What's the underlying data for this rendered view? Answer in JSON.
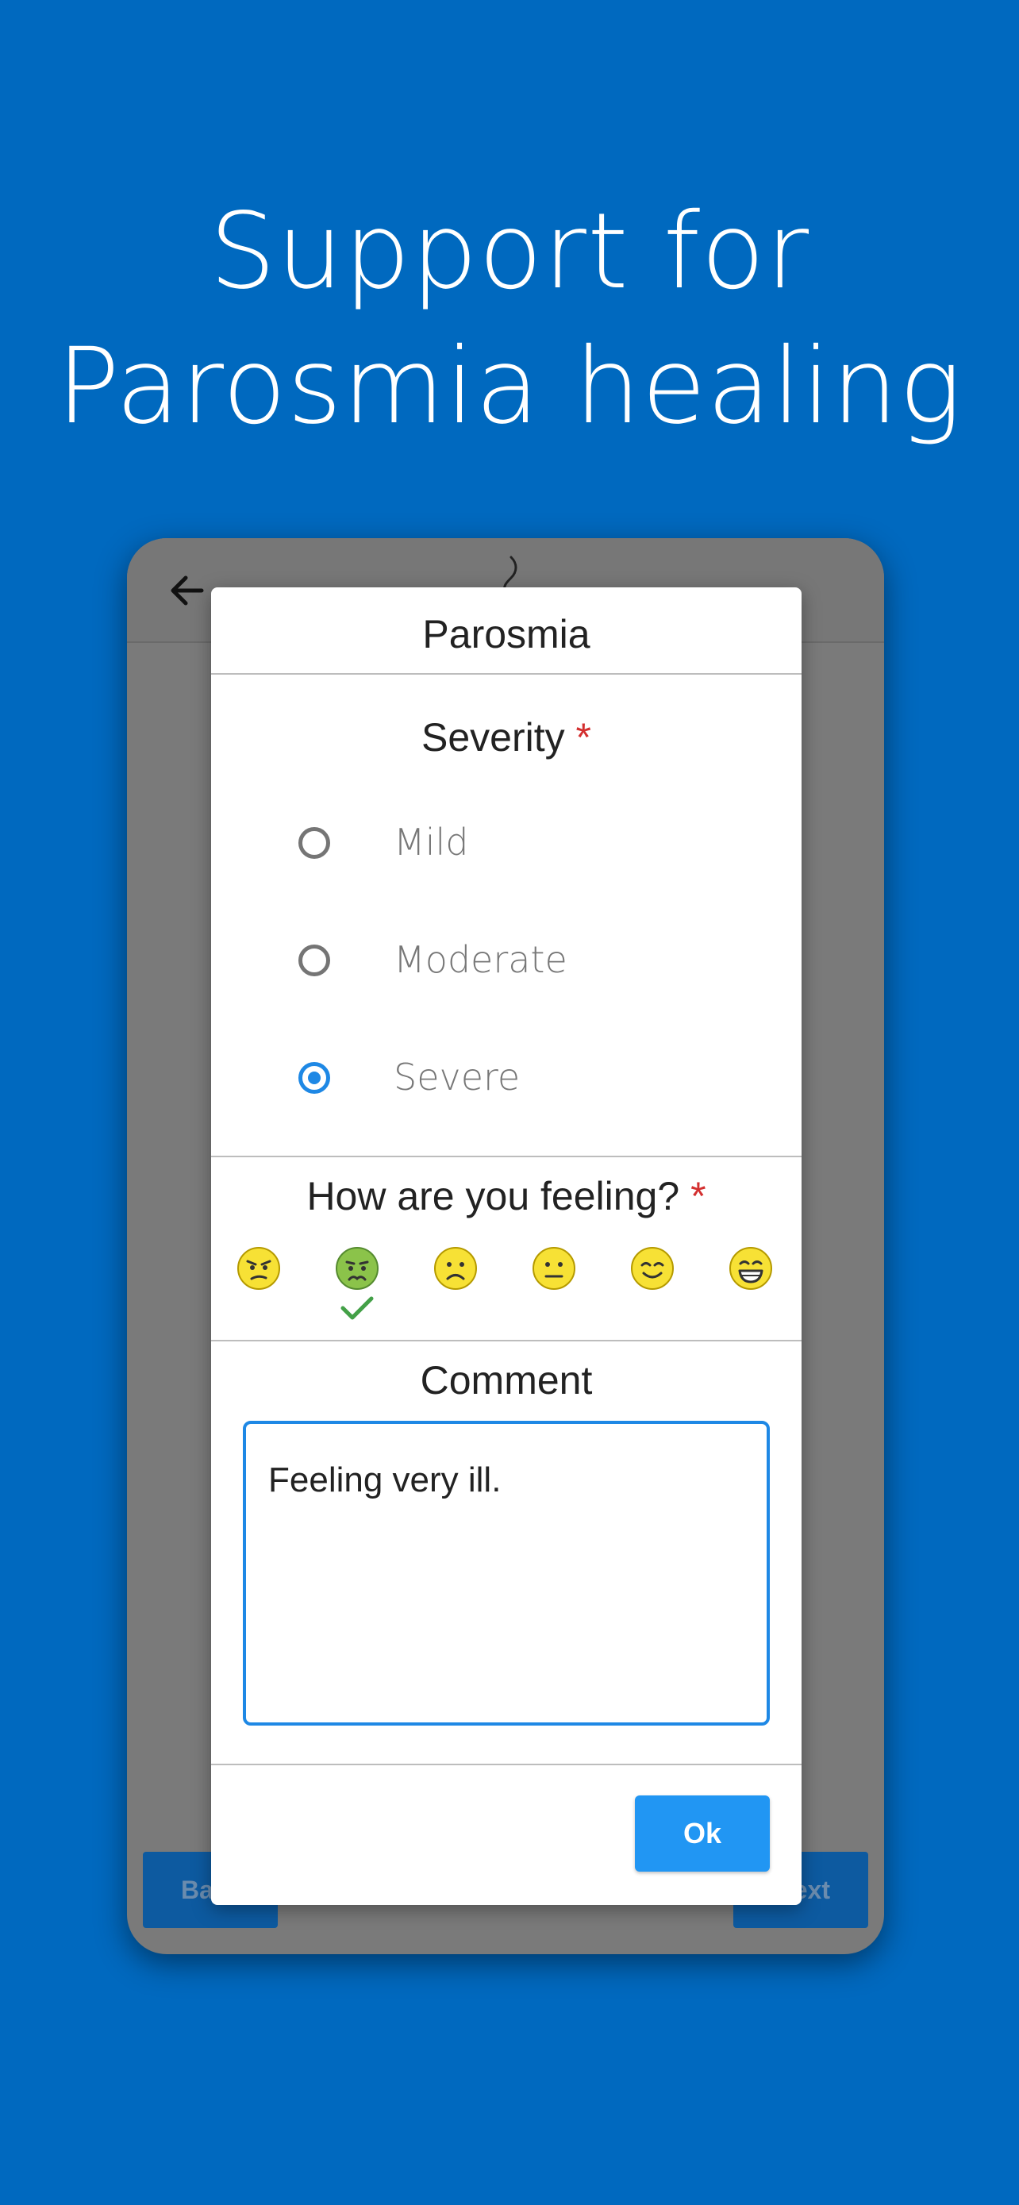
{
  "headline": {
    "line1": "Support for",
    "line2": "Parosmia healing"
  },
  "phone": {
    "back_button_label": "Ba",
    "next_button_label": "ext"
  },
  "dialog": {
    "title": "Parosmia",
    "severity": {
      "label": "Severity",
      "required_mark": "*",
      "options": [
        {
          "label": "Mild",
          "selected": false
        },
        {
          "label": "Moderate",
          "selected": false
        },
        {
          "label": "Severe",
          "selected": true
        }
      ]
    },
    "feeling": {
      "label": "How are you feeling?",
      "required_mark": "*",
      "options": [
        {
          "icon": "angry-face-icon",
          "selected": false
        },
        {
          "icon": "sick-face-icon",
          "selected": true
        },
        {
          "icon": "frowning-face-icon",
          "selected": false
        },
        {
          "icon": "neutral-face-icon",
          "selected": false
        },
        {
          "icon": "smiling-face-icon",
          "selected": false
        },
        {
          "icon": "grinning-face-icon",
          "selected": false
        }
      ]
    },
    "comment": {
      "label": "Comment",
      "value": "Feeling very ill."
    },
    "ok_label": "Ok"
  },
  "colors": {
    "background": "#0069BF",
    "accent": "#2196F3",
    "required": "#D32F2F",
    "check": "#43A047"
  }
}
